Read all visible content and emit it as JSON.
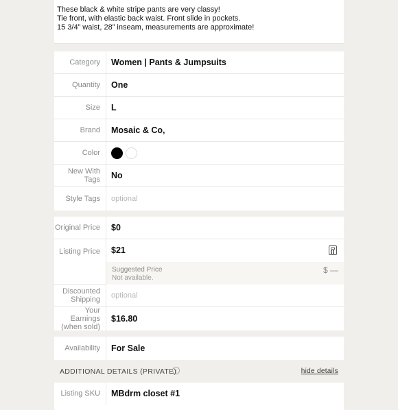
{
  "description": {
    "lines": [
      "These black & white stripe pants are very classy!",
      "Tie front, with elastic back waist. Front slide in pockets.",
      "15 3/4” waist, 28” inseam, measurements are approximate!"
    ]
  },
  "details": {
    "category": {
      "label": "Category",
      "value": "Women  |  Pants & Jumpsuits"
    },
    "quantity": {
      "label": "Quantity",
      "value": "One"
    },
    "size": {
      "label": "Size",
      "value": "L"
    },
    "brand": {
      "label": "Brand",
      "value": "Mosaic & Co,"
    },
    "color": {
      "label": "Color",
      "swatches": [
        "#000000",
        "#ffffff"
      ]
    },
    "new_with_tags": {
      "label": "New With Tags",
      "value": "No"
    },
    "style_tags": {
      "label": "Style Tags",
      "placeholder": "optional"
    }
  },
  "pricing": {
    "original": {
      "label": "Original Price",
      "value": "$0"
    },
    "listing": {
      "label": "Listing Price",
      "value": "$21",
      "icon": "calculator-icon"
    },
    "suggested": {
      "label": "Suggested Price",
      "status": "Not available.",
      "value": "$ —"
    },
    "discounted_shipping": {
      "label": "Discounted Shipping",
      "placeholder": "optional"
    },
    "earnings": {
      "label": "Your Earnings (when sold)",
      "value": "$16.80"
    }
  },
  "availability": {
    "label": "Availability",
    "value": "For Sale"
  },
  "additional": {
    "heading": "ADDITIONAL DETAILS (PRIVATE)",
    "info_icon": "info-icon",
    "toggle": "hide details"
  },
  "sku": {
    "label": "Listing SKU",
    "value": "MBdrm closet #1"
  }
}
